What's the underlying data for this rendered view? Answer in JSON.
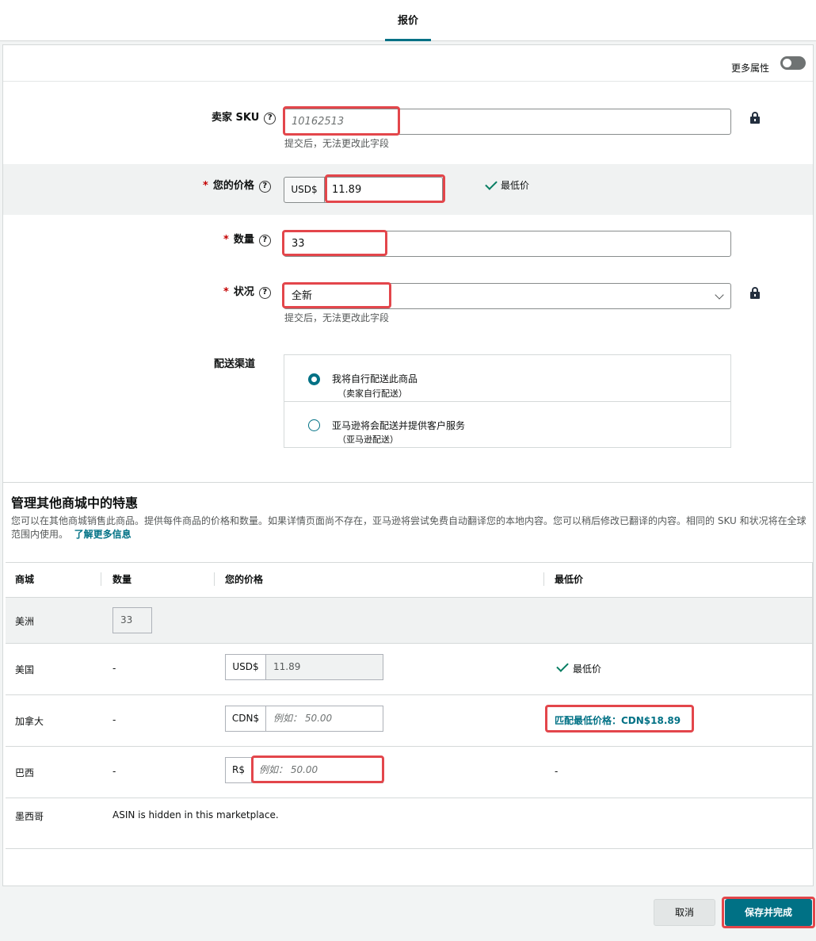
{
  "tabs": {
    "active": "报价"
  },
  "more_attributes": {
    "label": "更多属性",
    "enabled": false
  },
  "form": {
    "sku": {
      "label": "卖家 SKU",
      "placeholder": "10162513",
      "hint": "提交后，无法更改此字段"
    },
    "price": {
      "required": "*",
      "label": "您的价格",
      "currency": "USD$",
      "value": "11.89",
      "badge": "最低价"
    },
    "quantity": {
      "required": "*",
      "label": "数量",
      "value": "33"
    },
    "condition": {
      "required": "*",
      "label": "状况",
      "value": "全新",
      "hint": "提交后，无法更改此字段"
    },
    "fulfillment": {
      "label": "配送渠道",
      "options": [
        {
          "main": "我将自行配送此商品",
          "sub": "（卖家自行配送）",
          "selected": true
        },
        {
          "main": "亚马逊将会配送并提供客户服务",
          "sub": "（亚马逊配送）",
          "selected": false
        }
      ]
    }
  },
  "other_marketplaces": {
    "title": "管理其他商城中的特惠",
    "description": "您可以在其他商城销售此商品。提供每件商品的价格和数量。如果详情页面尚不存在，亚马逊将尝试免费自动翻译您的本地内容。您可以稍后修改已翻译的内容。相同的 SKU 和状况将在全球范围内使用。",
    "learn_more": "了解更多信息",
    "headers": [
      "商城",
      "数量",
      "您的价格",
      "最低价"
    ],
    "rows": [
      {
        "market": "美洲",
        "quantity": "33"
      },
      {
        "market": "美国",
        "quantity": "-",
        "currency": "USD$",
        "price": "11.89",
        "lowest": "最低价"
      },
      {
        "market": "加拿大",
        "quantity": "-",
        "currency": "CDN$",
        "price_placeholder": "例如：  50.00",
        "lowest": "匹配最低价格：CDN$18.89"
      },
      {
        "market": "巴西",
        "quantity": "-",
        "currency": "R$",
        "price_placeholder": "例如：  50.00",
        "lowest": "-"
      },
      {
        "market": "墨西哥",
        "note": "ASIN is hidden in this marketplace."
      }
    ]
  },
  "footer": {
    "cancel": "取消",
    "save": "保存并完成"
  }
}
